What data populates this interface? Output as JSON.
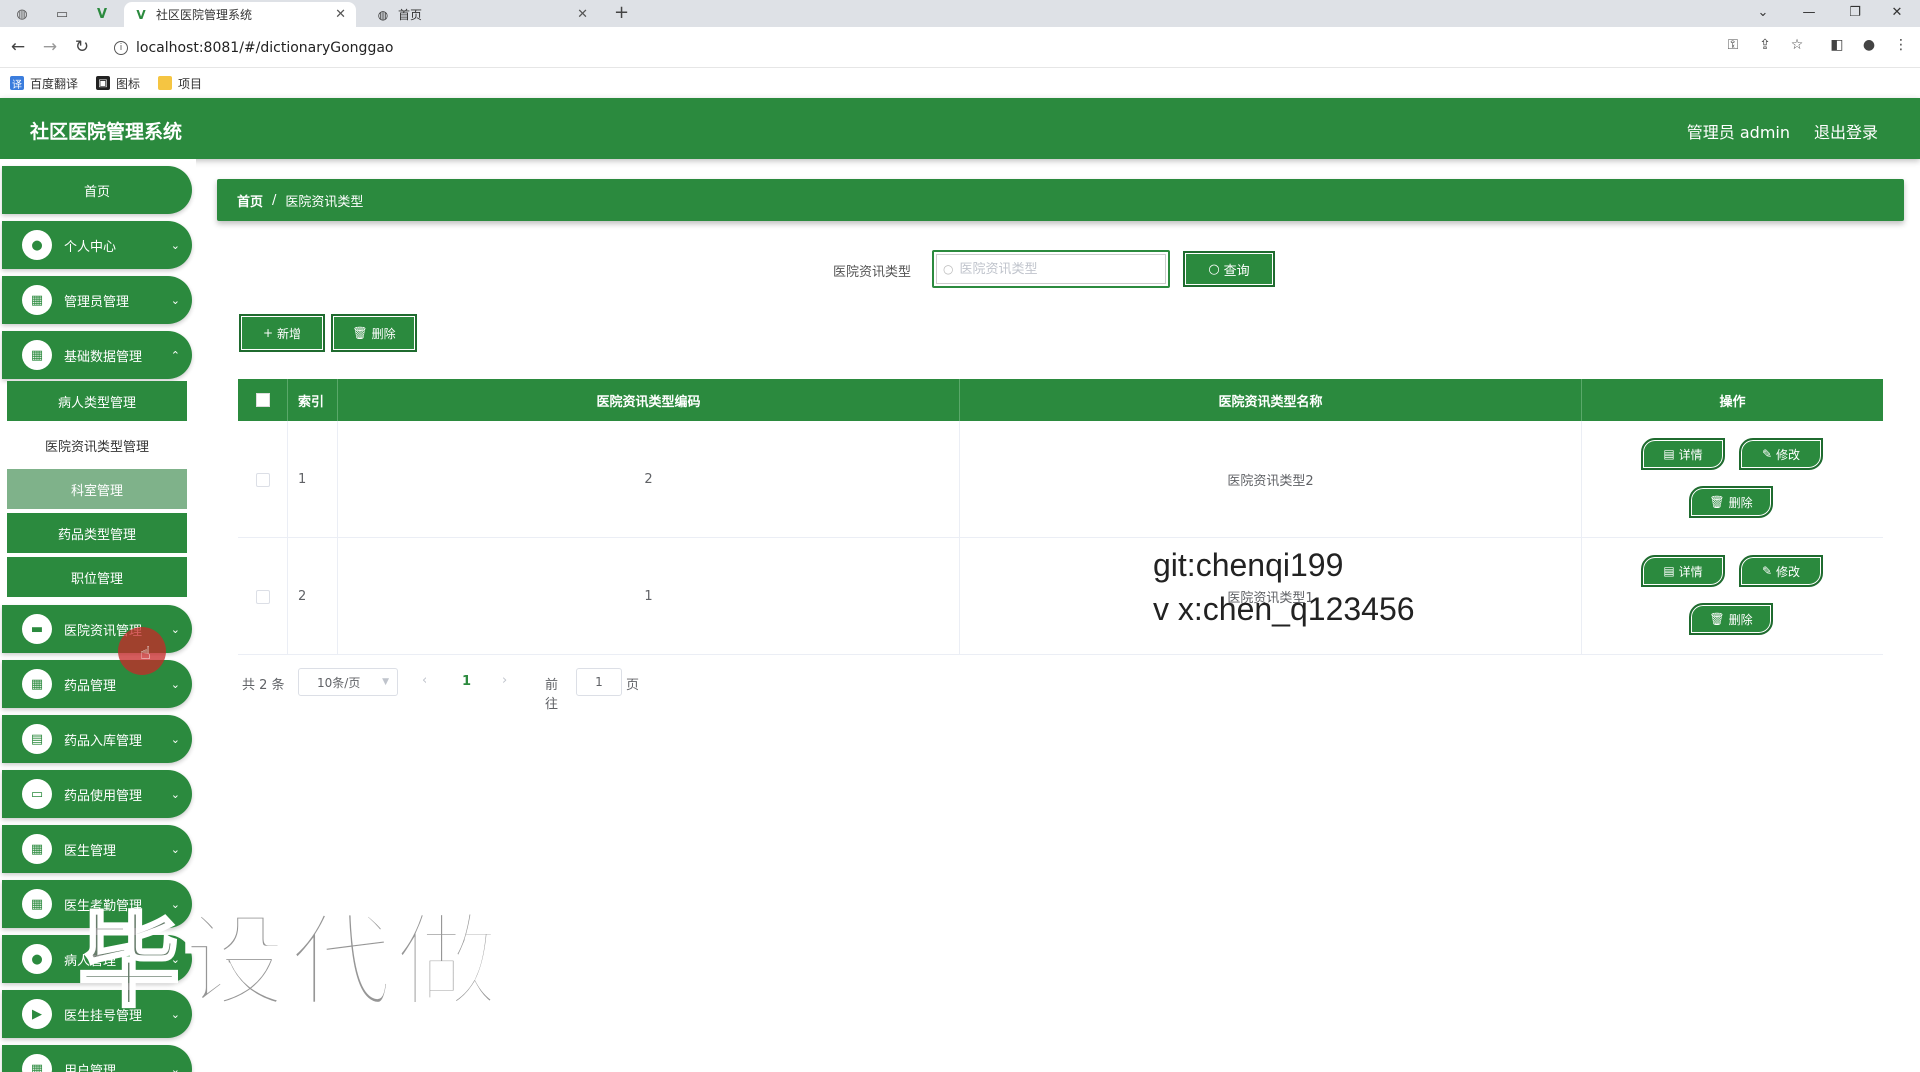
{
  "browser": {
    "tabs": [
      {
        "title": "社区医院管理系统",
        "active": true
      },
      {
        "title": "首页",
        "active": false
      }
    ],
    "url": "localhost:8081/#/dictionaryGonggao",
    "bookmarks": [
      {
        "label": "百度翻译",
        "icon": "translate-icon"
      },
      {
        "label": "图标",
        "icon": "image-icon"
      },
      {
        "label": "项目",
        "icon": "folder-icon"
      }
    ]
  },
  "header": {
    "title": "社区医院管理系统",
    "user": "管理员 admin",
    "logout": "退出登录"
  },
  "sidebar": {
    "home": "首页",
    "groups": [
      {
        "label": "个人中心",
        "icon": "user-icon"
      },
      {
        "label": "管理员管理",
        "icon": "grid-icon"
      },
      {
        "label": "基础数据管理",
        "icon": "grid-icon"
      }
    ],
    "submenu": [
      {
        "label": "病人类型管理"
      },
      {
        "label": "医院资讯类型管理",
        "active": true
      },
      {
        "label": "科室管理",
        "hover": true
      },
      {
        "label": "药品类型管理"
      },
      {
        "label": "职位管理"
      }
    ],
    "groups_after": [
      {
        "label": "医院资讯管理",
        "icon": "monitor-icon"
      },
      {
        "label": "药品管理",
        "icon": "grid-icon"
      },
      {
        "label": "药品入库管理",
        "icon": "clipboard-icon"
      },
      {
        "label": "药品使用管理",
        "icon": "chat-icon"
      },
      {
        "label": "医生管理",
        "icon": "grid-icon"
      },
      {
        "label": "医生考勤管理",
        "icon": "grid-icon"
      },
      {
        "label": "病人管理",
        "icon": "location-icon"
      },
      {
        "label": "医生挂号管理",
        "icon": "video-icon"
      },
      {
        "label": "用户管理",
        "icon": "grid-icon"
      }
    ]
  },
  "breadcrumb": {
    "home": "首页",
    "separator": "/",
    "current": "医院资讯类型"
  },
  "search": {
    "label": "医院资讯类型",
    "placeholder": "医院资讯类型",
    "value": "",
    "button": "查询"
  },
  "toolbar": {
    "add": "新增",
    "delete": "删除"
  },
  "table": {
    "headers": {
      "index": "索引",
      "code": "医院资讯类型编码",
      "name": "医院资讯类型名称",
      "actions": "操作"
    },
    "rows": [
      {
        "index": "1",
        "code": "2",
        "name": "医院资讯类型2"
      },
      {
        "index": "2",
        "code": "1",
        "name": "医院资讯类型1"
      }
    ],
    "row_actions": {
      "detail": "详情",
      "edit": "修改",
      "delete": "删除"
    }
  },
  "pagination": {
    "total": "共 2 条",
    "page_size": "10条/页",
    "current_page": "1",
    "goto_label": "前往",
    "goto_value": "1",
    "page_suffix": "页"
  },
  "watermarks": {
    "line1": "git:chenqi199",
    "line2": "v x:chen_q123456",
    "big": "毕设代做"
  },
  "colors": {
    "primary": "#2b8a3e",
    "active_submenu": "#ffffff",
    "hover_submenu": "#7fb28a"
  }
}
